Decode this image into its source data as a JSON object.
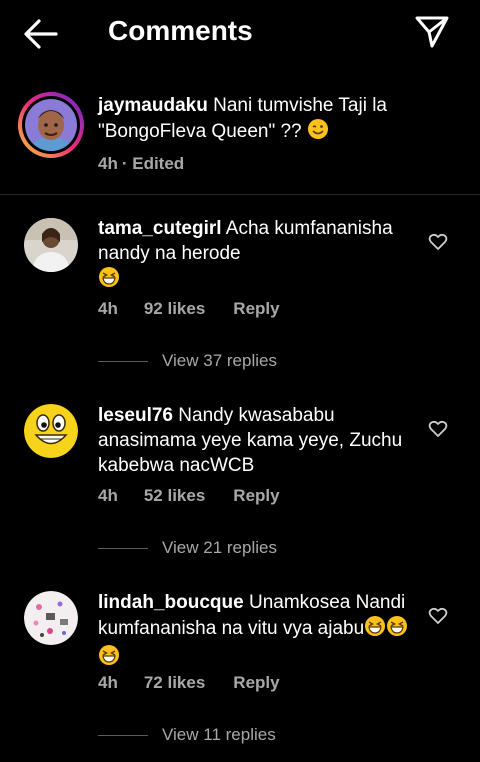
{
  "header": {
    "title": "Comments"
  },
  "caption": {
    "username": "jaymaudaku",
    "text": " Nani tumvishe Taji la \"BongoFleva Queen\" ?? ",
    "time": "4h",
    "edited": "· Edited"
  },
  "comments": [
    {
      "username": "tama_cutegirl",
      "text": " Acha kumfananisha nandy na herode ",
      "time": "4h",
      "likes": "92 likes",
      "reply": "Reply",
      "view_replies": "View 37 replies"
    },
    {
      "username": "leseul76",
      "text": " Nandy kwasababu anasimama yeye kama yeye, Zuchu kabebwa nacWCB",
      "time": "4h",
      "likes": "52 likes",
      "reply": "Reply",
      "view_replies": "View 21 replies"
    },
    {
      "username": "lindah_boucque",
      "text": " Unamkosea Nandi kumfananisha na vitu vya ajabu",
      "time": "4h",
      "likes": "72 likes",
      "reply": "Reply",
      "view_replies": "View 11 replies"
    }
  ],
  "icons": {
    "back": "arrow-left-icon",
    "send": "paper-plane-icon",
    "like": "heart-outline-icon",
    "wink": "winking-face-emoji",
    "grin": "grinning-squinting-face-emoji"
  },
  "colors": {
    "background": "#000000",
    "text": "#ffffff",
    "secondary": "#a8a8a8",
    "divider": "#262626"
  }
}
